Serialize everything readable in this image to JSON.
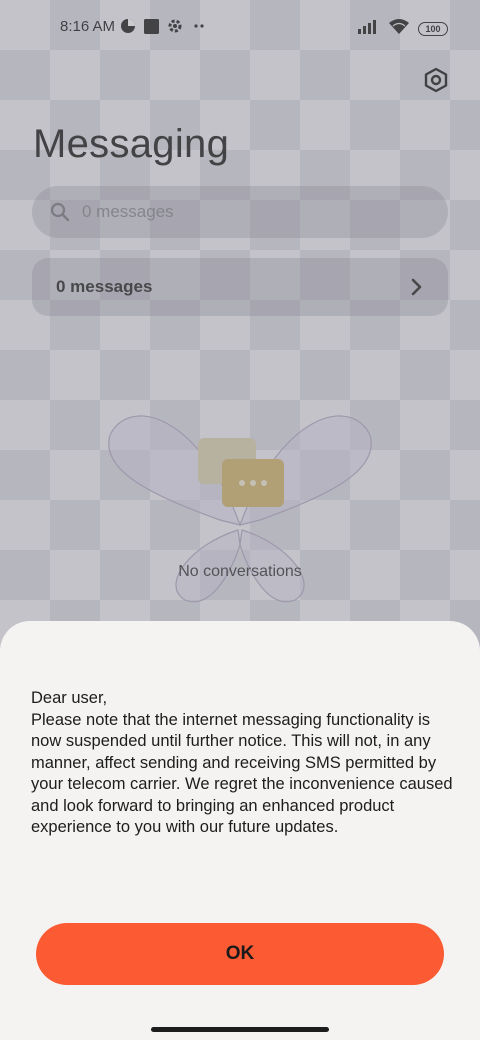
{
  "status_bar": {
    "time": "8:16 AM",
    "battery": "100",
    "icons": [
      "data-saver-icon",
      "square-icon",
      "gear-icon",
      "more-dots-icon",
      "signal-icon",
      "wifi-icon",
      "battery-icon"
    ]
  },
  "header": {
    "title": "Messaging",
    "settings_icon": "settings-hexagon-icon"
  },
  "search": {
    "placeholder": "0 messages",
    "icon": "search-icon"
  },
  "summary_row": {
    "label": "0 messages",
    "icon": "chevron-right-icon"
  },
  "empty_state": {
    "text": "No conversations",
    "illustration_icon": "butterfly-chat-bubbles-illustration"
  },
  "dialog": {
    "lines": [
      "Dear user,",
      "Please note that the internet messaging functionality is now suspended until further notice. This will not, in any manner, affect sending and receiving SMS permitted by your telecom carrier. We regret the inconvenience caused and look forward to bringing an enhanced product experience to you with our future updates."
    ],
    "ok_label": "OK"
  },
  "colors": {
    "accent": "#fb5a33",
    "sheet_background": "#f4f3f1"
  }
}
